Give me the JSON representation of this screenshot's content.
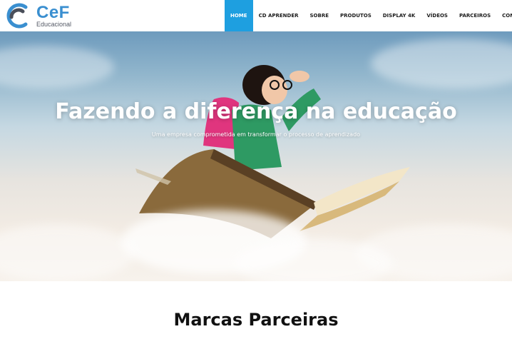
{
  "brand": {
    "name": "CeF",
    "tagline": "Educacional",
    "color": "#3a8fd0"
  },
  "nav": {
    "items": [
      {
        "label": "HOME",
        "active": true
      },
      {
        "label": "CD APRENDER",
        "active": false
      },
      {
        "label": "SOBRE",
        "active": false
      },
      {
        "label": "PRODUTOS",
        "active": false
      },
      {
        "label": "DISPLAY 4K",
        "active": false
      },
      {
        "label": "VÍDEOS",
        "active": false
      },
      {
        "label": "PARCEIROS",
        "active": false
      },
      {
        "label": "CONTATO",
        "active": false
      }
    ],
    "active_color": "#1e9fe0"
  },
  "hero": {
    "title": "Fazendo a diferença na educação",
    "subtitle": "Uma empresa comprometida em transformar o processo de aprendizado",
    "image": "girl-flying-on-book-illustration"
  },
  "partners": {
    "title": "Marcas Parceiras"
  }
}
